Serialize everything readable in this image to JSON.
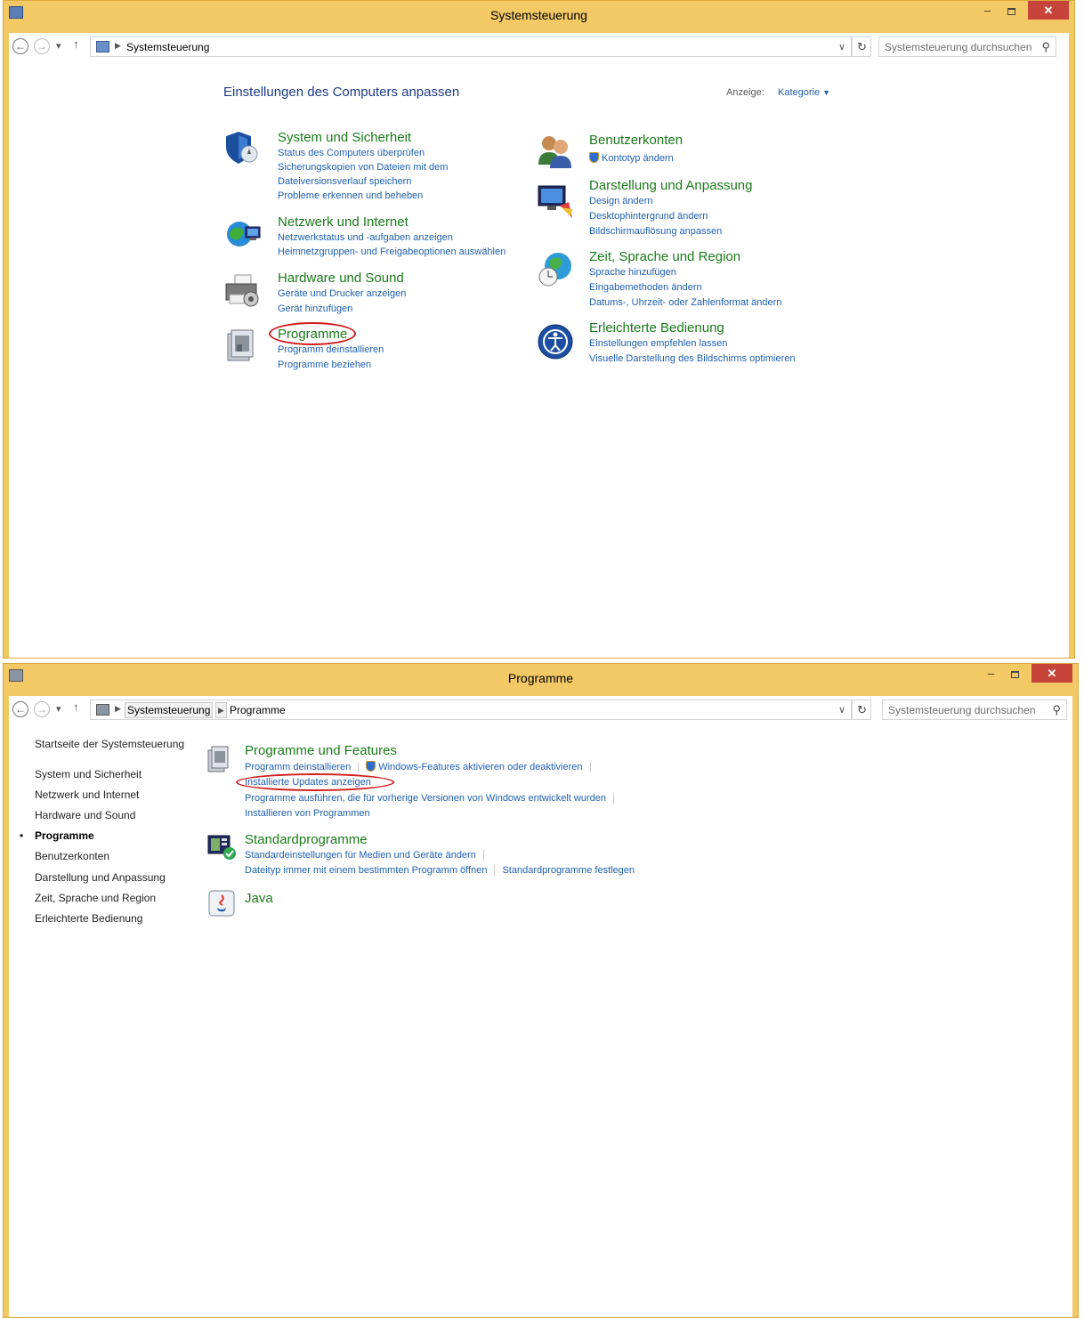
{
  "colors": {
    "frame": "#f3c966",
    "close_button": "#c7443a",
    "link": "#1f5fb1",
    "category_title": "#1a7a1a",
    "annotation_ellipse": "#d01b1b"
  },
  "window1": {
    "title": "Systemsteuerung",
    "breadcrumb": [
      "Systemsteuerung"
    ],
    "search_placeholder": "Systemsteuerung durchsuchen",
    "heading": "Einstellungen des Computers anpassen",
    "view_label": "Anzeige:",
    "view_value": "Kategorie",
    "left_column": [
      {
        "title": "System und Sicherheit",
        "icon": "shield-icon",
        "links": [
          "Status des Computers überprüfen",
          "Sicherungskopien von Dateien mit dem",
          "Dateiversionsverlauf speichern",
          "Probleme erkennen und beheben"
        ]
      },
      {
        "title": "Netzwerk und Internet",
        "icon": "globe-network-icon",
        "links": [
          "Netzwerkstatus und -aufgaben anzeigen",
          "Heimnetzgruppen- und Freigabeoptionen auswählen"
        ]
      },
      {
        "title": "Hardware und Sound",
        "icon": "printer-icon",
        "links": [
          "Geräte und Drucker anzeigen",
          "Gerät hinzufügen"
        ]
      },
      {
        "title": "Programme",
        "icon": "programs-icon",
        "links": [
          "Programm deinstallieren",
          "Programme beziehen"
        ]
      }
    ],
    "right_column": [
      {
        "title": "Benutzerkonten",
        "icon": "users-icon",
        "links": [
          "Kontotyp ändern"
        ]
      },
      {
        "title": "Darstellung und Anpassung",
        "icon": "display-icon",
        "links": [
          "Design ändern",
          "Desktophintergrund ändern",
          "Bildschirmauflösung anpassen"
        ]
      },
      {
        "title": "Zeit, Sprache und Region",
        "icon": "clock-globe-icon",
        "links": [
          "Sprache hinzufügen",
          "Eingabemethoden ändern",
          "Datums-, Uhrzeit- oder Zahlenformat ändern"
        ]
      },
      {
        "title": "Erleichterte Bedienung",
        "icon": "accessibility-icon",
        "links": [
          "Einstellungen empfehlen lassen",
          "Visuelle Darstellung des Bildschirms optimieren"
        ]
      }
    ]
  },
  "window2": {
    "title": "Programme",
    "breadcrumb": [
      "Systemsteuerung",
      "Programme"
    ],
    "search_placeholder": "Systemsteuerung durchsuchen",
    "sidebar": [
      "Startseite der Systemsteuerung",
      "System und Sicherheit",
      "Netzwerk und Internet",
      "Hardware und Sound",
      "Programme",
      "Benutzerkonten",
      "Darstellung und Anpassung",
      "Zeit, Sprache und Region",
      "Erleichterte Bedienung"
    ],
    "sections": [
      {
        "title": "Programme und Features",
        "icon": "programs-features-icon",
        "links": [
          "Programm deinstallieren",
          "Windows-Features aktivieren oder deaktivieren",
          "Installierte Updates anzeigen",
          "Programme ausführen, die für vorherige Versionen von Windows entwickelt wurden",
          "Installieren von Programmen"
        ]
      },
      {
        "title": "Standardprogramme",
        "icon": "default-programs-icon",
        "links": [
          "Standardeinstellungen für Medien und Geräte ändern",
          "Dateityp immer mit einem bestimmten Programm öffnen",
          "Standardprogramme festlegen"
        ]
      },
      {
        "title": "Java",
        "icon": "java-icon",
        "links": []
      }
    ]
  }
}
